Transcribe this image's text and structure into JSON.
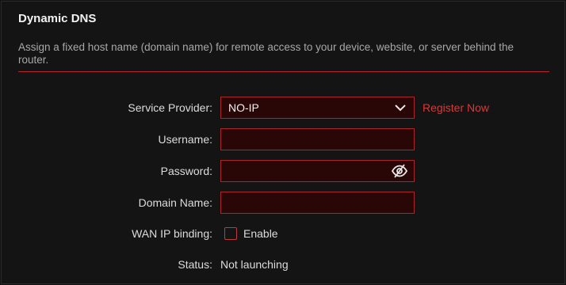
{
  "section": {
    "title": "Dynamic DNS",
    "description": "Assign a fixed host name (domain name) for remote access to your device, website, or server behind the router."
  },
  "form": {
    "service_provider": {
      "label": "Service Provider:",
      "value": "NO-IP",
      "register_link": "Register Now"
    },
    "username": {
      "label": "Username:",
      "value": "",
      "placeholder": ""
    },
    "password": {
      "label": "Password:",
      "value": "",
      "placeholder": "",
      "visibility_icon": "eye-slash-icon"
    },
    "domain_name": {
      "label": "Domain Name:",
      "value": "",
      "placeholder": ""
    },
    "wan_ip_binding": {
      "label": "WAN IP binding:",
      "checkbox_label": "Enable",
      "checked": false
    },
    "status": {
      "label": "Status:",
      "value": "Not launching"
    }
  },
  "colors": {
    "accent": "#b3242c",
    "link": "#d23b3b",
    "field_bg": "#2a0707",
    "background": "#141414"
  }
}
